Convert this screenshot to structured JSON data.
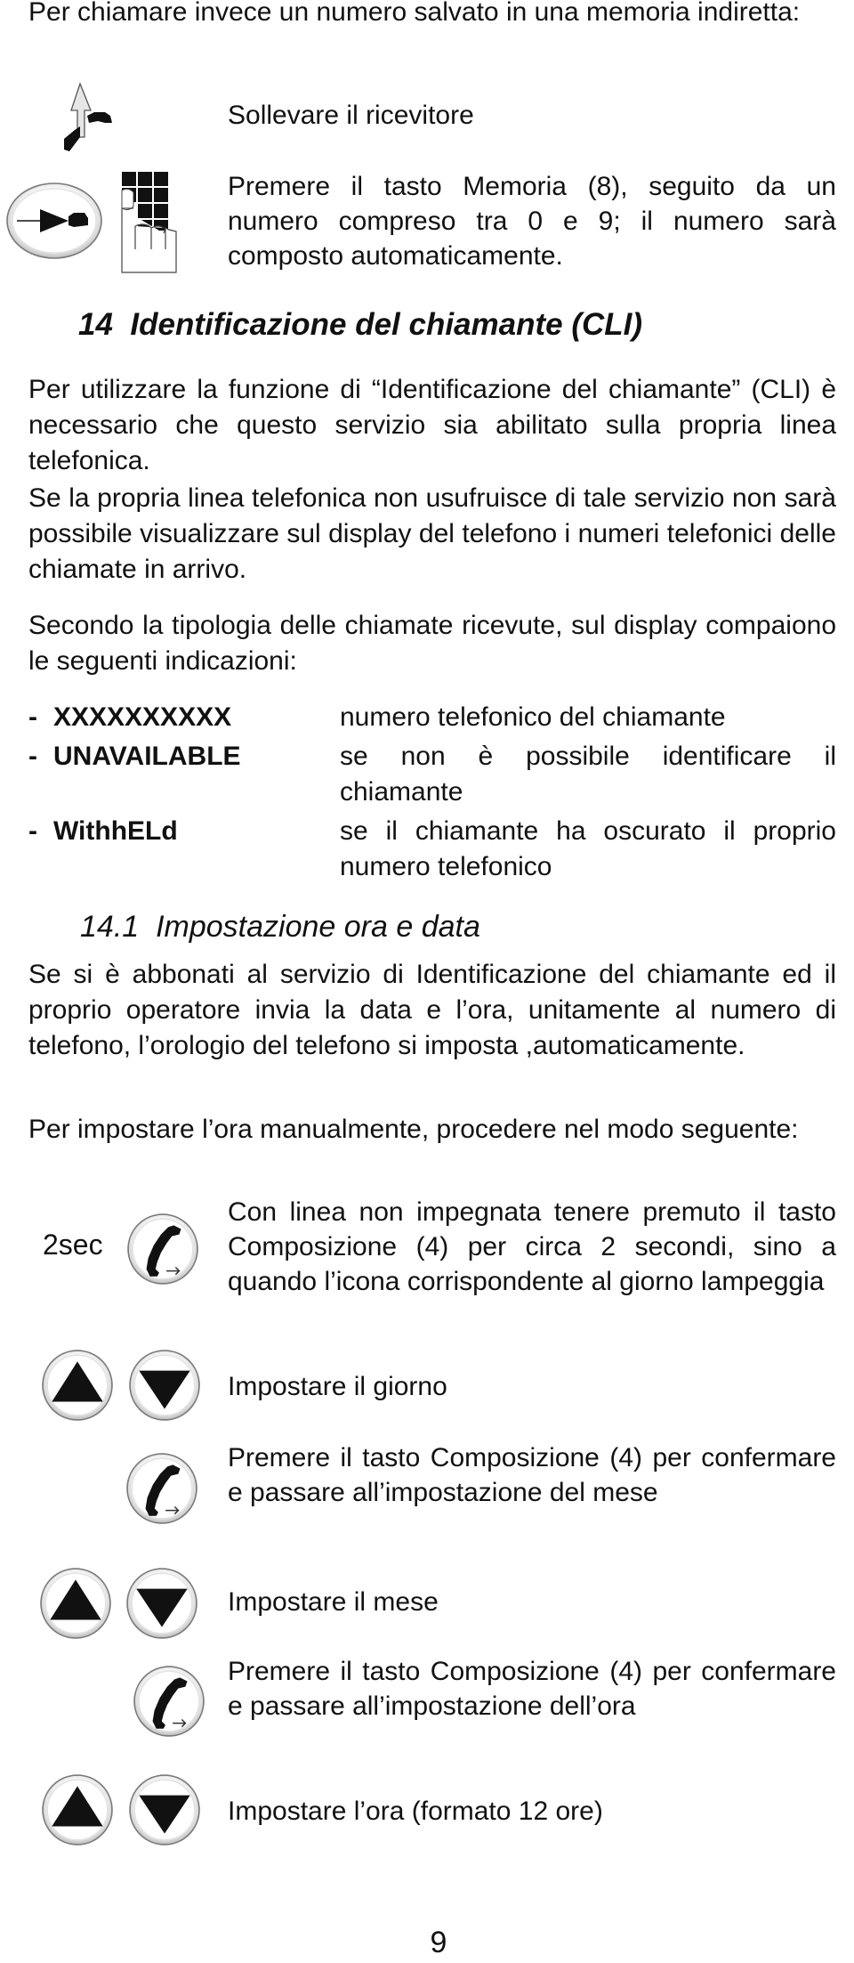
{
  "intro": {
    "text": "Per chiamare invece un numero salvato in una memoria indiretta:"
  },
  "memory_steps": [
    {
      "icon": "lift-handset-icon",
      "text": "Sollevare il ricevitore"
    },
    {
      "icon": "memory-key-icon",
      "icon2": "keypad-press-icon",
      "text": "Premere il tasto Memoria (8), seguito da un numero compreso tra 0 e 9; il numero sarà composto automaticamente."
    }
  ],
  "section14": {
    "number": "14",
    "title": "Identificazione del chiamante (CLI)",
    "paragraphs": [
      "Per utilizzare la funzione di “Identificazione del chiamante” (CLI) è necessario che questo servizio sia abilitato sulla propria linea telefonica.",
      "Se la propria linea telefonica non usufruisce di tale servizio non sarà possibile visualizzare sul display del telefono i numeri telefonici delle chiamate in arrivo.",
      "Secondo la tipologia delle chiamate ricevute, sul display compaiono le seguenti indicazioni:"
    ],
    "indications": [
      {
        "dash": "-",
        "label": "XXXXXXXXXX",
        "description": "numero telefonico del chiamante"
      },
      {
        "dash": "-",
        "label": "UNAVAILABLE",
        "description": "se non è possibile identificare il chiamante"
      },
      {
        "dash": "-",
        "label": "WithhELd",
        "description": "se il chiamante ha oscurato il proprio numero telefonico"
      }
    ]
  },
  "section14_1": {
    "number": "14.1",
    "title": "Impostazione ora e data",
    "paragraphs": [
      "Se si è abbonati al servizio di Identificazione del chiamante ed il proprio operatore invia la data e l’ora, unitamente al numero di telefono, l’orologio del telefono si imposta ,automaticamente.",
      "Per impostare l’ora manualmente, procedere nel modo seguente:"
    ],
    "hold_label": "2sec",
    "steps": [
      {
        "icon": "dial-key-icon",
        "text": "Con linea non impegnata tenere premuto il tasto Composizione (4) per circa 2 secondi, sino a quando l’icona corrispondente al giorno lampeggia"
      },
      {
        "icon": "up-down-keys-icon",
        "text": "Impostare il giorno"
      },
      {
        "icon": "dial-key-icon",
        "text": "Premere il tasto Composizione (4) per confermare e passare all’impostazione del mese"
      },
      {
        "icon": "up-down-keys-icon",
        "text": "Impostare il mese"
      },
      {
        "icon": "dial-key-icon",
        "text": "Premere il tasto Composizione (4) per confermare e passare all’impostazione dell’ora"
      },
      {
        "icon": "up-down-keys-icon",
        "text": "Impostare l’ora (formato 12 ore)"
      }
    ]
  },
  "footer": {
    "page_number": "9"
  }
}
